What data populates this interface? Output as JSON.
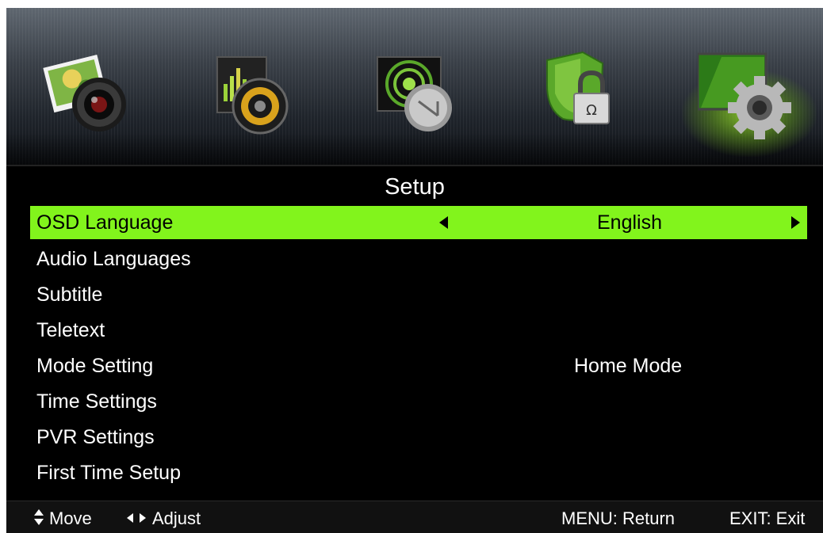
{
  "icon_bar": {
    "icons": [
      {
        "name": "picture-icon",
        "active": false
      },
      {
        "name": "sound-icon",
        "active": false
      },
      {
        "name": "channel-icon",
        "active": false
      },
      {
        "name": "lock-icon",
        "active": false
      },
      {
        "name": "setup-icon",
        "active": true
      }
    ],
    "active_glow_color": "#8fd42a"
  },
  "title": "Setup",
  "menu": {
    "selected_color": "#82f41c",
    "items": [
      {
        "label": "OSD Language",
        "value": "English",
        "selected": true
      },
      {
        "label": "Audio Languages",
        "value": ""
      },
      {
        "label": "Subtitle",
        "value": ""
      },
      {
        "label": "Teletext",
        "value": ""
      },
      {
        "label": "Mode Setting",
        "value": "Home Mode"
      },
      {
        "label": "Time Settings",
        "value": ""
      },
      {
        "label": "PVR Settings",
        "value": ""
      },
      {
        "label": "First Time Setup",
        "value": ""
      }
    ]
  },
  "footer": {
    "move": "Move",
    "adjust": "Adjust",
    "menu_return": "MENU: Return",
    "exit": "EXIT: Exit"
  }
}
